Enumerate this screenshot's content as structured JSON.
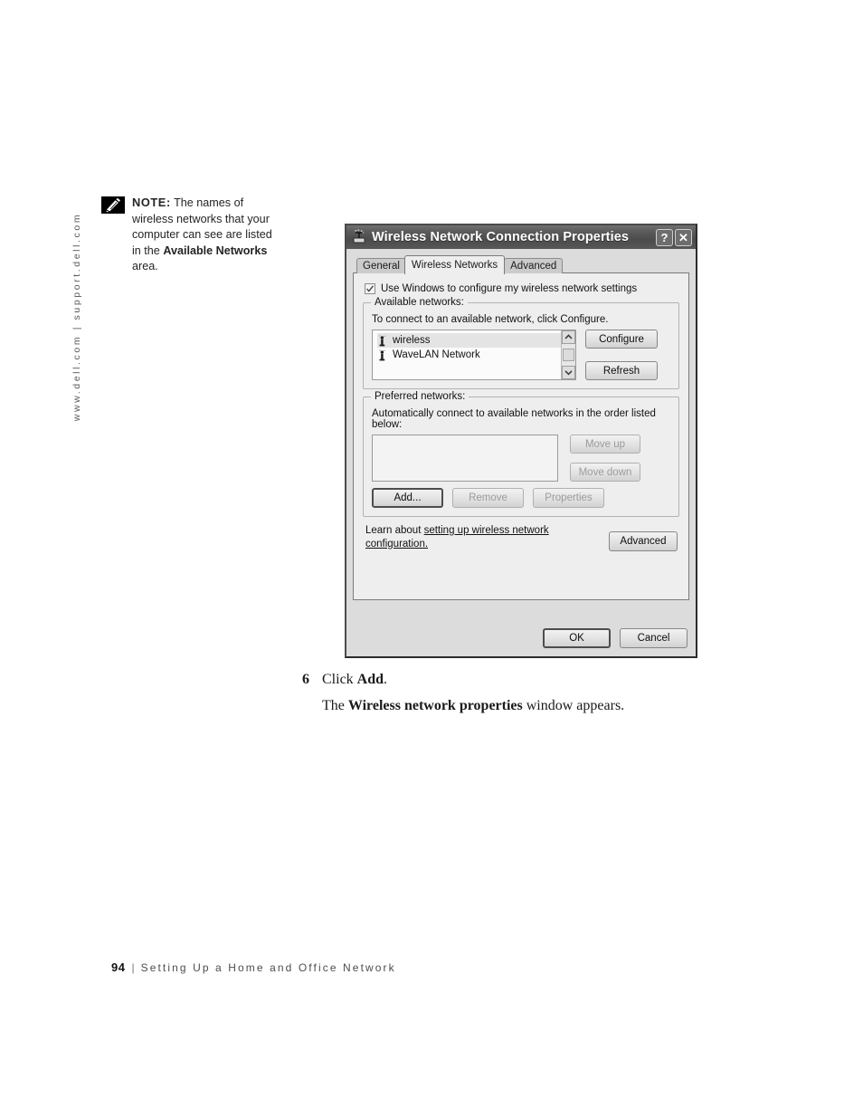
{
  "sidebar": {
    "url_rail": "www.dell.com | support.dell.com"
  },
  "note": {
    "icon": "pencil-note-icon",
    "label": "NOTE:",
    "text_part1": " The names of wireless networks that your computer can see are listed in the ",
    "bold_term": "Available Networks",
    "text_part2": " area."
  },
  "dialog": {
    "title": "Wireless Network Connection Properties",
    "title_icon": "wireless-network-icon",
    "help_button": "?",
    "close_button": "✕",
    "tabs": [
      {
        "label": "General",
        "active": false
      },
      {
        "label": "Wireless Networks",
        "active": true
      },
      {
        "label": "Advanced",
        "active": false
      }
    ],
    "use_windows": {
      "label": "Use Windows to configure my wireless network settings",
      "checked": true
    },
    "available_networks": {
      "group_title": "Available networks:",
      "hint": "To connect to an available network, click Configure.",
      "items": [
        {
          "name": "wireless",
          "icon": "wireless-signal-icon",
          "selected": true
        },
        {
          "name": "WaveLAN Network",
          "icon": "wireless-signal-icon",
          "selected": false
        }
      ],
      "configure_button": "Configure",
      "refresh_button": "Refresh"
    },
    "preferred_networks": {
      "group_title": "Preferred networks:",
      "hint": "Automatically connect to available networks in the order listed below:",
      "items": [],
      "move_up_button": "Move up",
      "move_down_button": "Move down",
      "add_button": "Add...",
      "remove_button": "Remove",
      "properties_button": "Properties"
    },
    "learn": {
      "prefix": "Learn about ",
      "link": "setting up wireless network configuration.",
      "advanced_button": "Advanced"
    },
    "footer": {
      "ok_button": "OK",
      "cancel_button": "Cancel"
    }
  },
  "body_copy": {
    "step_number": "6",
    "step_prefix": "Click ",
    "step_bold": "Add",
    "step_suffix": ".",
    "follow_prefix": "The ",
    "follow_bold": "Wireless network properties",
    "follow_suffix": " window appears."
  },
  "page_footer": {
    "page_number": "94",
    "separator": "|",
    "title": "Setting Up a Home and Office Network"
  },
  "colors": {
    "titlebar": "#575757",
    "dialog_face": "#dcdcdc",
    "tab_panel": "#eeeeee",
    "note_icon_bg": "#000000"
  }
}
